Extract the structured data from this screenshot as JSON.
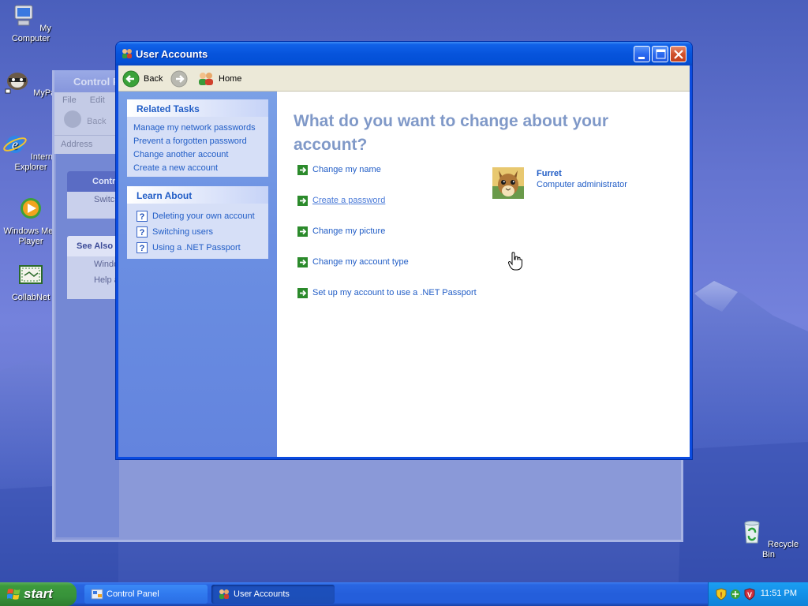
{
  "desktop": {
    "icons": [
      {
        "label": "My Computer",
        "icon": "my-computer-icon"
      },
      {
        "label": "MyPal",
        "icon": "mypal-icon"
      },
      {
        "label": "Internet Explorer",
        "icon": "internet-explorer-icon"
      },
      {
        "label": "Windows Media Player",
        "icon": "media-player-icon"
      },
      {
        "label": "CollabNet",
        "icon": "collabnet-icon"
      },
      {
        "label": "Recycle Bin",
        "icon": "recycle-bin-icon"
      }
    ]
  },
  "control_panel": {
    "title": "Control P",
    "menu": [
      "File",
      "Edit"
    ],
    "back_label": "Back",
    "address_label": "Address",
    "panel1": {
      "title": "Contro",
      "item": "Switch"
    },
    "panel2": {
      "title": "See Also",
      "items": [
        "Windo",
        "Help a"
      ]
    }
  },
  "window": {
    "title": "User Accounts",
    "nav": {
      "back": "Back",
      "home": "Home"
    },
    "related_tasks": {
      "title": "Related Tasks",
      "items": [
        "Manage my network passwords",
        "Prevent a forgotten password",
        "Change another account",
        "Create a new account"
      ]
    },
    "learn_about": {
      "title": "Learn About",
      "items": [
        "Deleting your own account",
        "Switching users",
        "Using a .NET Passport"
      ]
    },
    "headline": "What do you want to change about your account?",
    "tasks": [
      "Change my name",
      "Create a password",
      "Change my picture",
      "Change my account type",
      "Set up my account to use a .NET Passport"
    ],
    "user": {
      "name": "Furret",
      "role": "Computer administrator"
    }
  },
  "taskbar": {
    "start": "start",
    "buttons": [
      "Control Panel",
      "User Accounts"
    ],
    "active_button": "User Accounts",
    "clock": "11:51 PM"
  },
  "colors": {
    "link": "#215dc6",
    "headline": "#8099c8",
    "titlebar": "#0754dc"
  }
}
